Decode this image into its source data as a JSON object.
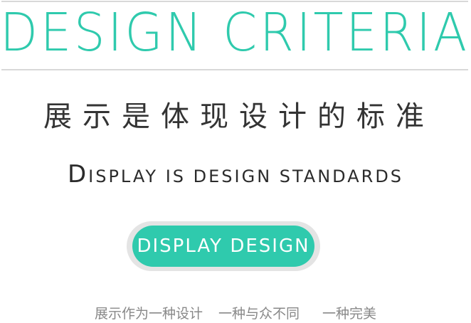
{
  "hero": {
    "title": "DESIGN  CRITERIA"
  },
  "heading": {
    "chinese": "展示是体现设计的标准",
    "english_first": "D",
    "english_rest": "isplay is design standards"
  },
  "button": {
    "label": "DISPLAY DESIGN"
  },
  "tagline": {
    "part1": "展示作为一种设计",
    "part2": "一种与众不同",
    "part3": "一种完美"
  },
  "colors": {
    "accent": "#2fcaad",
    "rule": "#d8d8d8",
    "button_ring": "#e4e4e4",
    "heading_text": "#333333",
    "tagline_text": "#888888"
  }
}
